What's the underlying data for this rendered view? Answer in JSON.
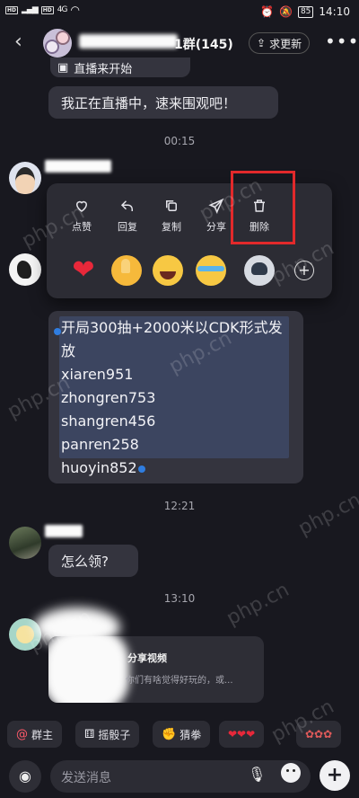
{
  "status_bar": {
    "time": "14:10",
    "battery": "85",
    "sim1": "HD",
    "sim2": "HD",
    "network": "4G"
  },
  "header": {
    "title": "1群(145)",
    "update_button": "求更新"
  },
  "messages": {
    "live_strip": "直播来开始",
    "live_msg": "我正在直播中，速来围观吧！",
    "time1": "00:15",
    "cdk_lines": [
      "开局300抽+2000米以CDK形式发",
      "放",
      "xiaren951",
      "zhongren753",
      "shangren456",
      "panren258",
      "huoyin852"
    ],
    "time2": "12:21",
    "howto": "怎么领?",
    "time3": "13:10",
    "share_title": "分享视频",
    "share_desc": "你们有啥觉得好玩的，或..."
  },
  "context_menu": {
    "items": [
      {
        "label": "点赞",
        "icon": "heart-outline-icon"
      },
      {
        "label": "回复",
        "icon": "reply-icon"
      },
      {
        "label": "复制",
        "icon": "copy-icon"
      },
      {
        "label": "分享",
        "icon": "share-icon"
      },
      {
        "label": "删除",
        "icon": "trash-icon"
      }
    ],
    "reactions": [
      "heart-emoji",
      "thumbs-up-emoji",
      "laughing-emoji",
      "crying-laugh-emoji",
      "dog-emoji"
    ],
    "highlight_color": "#e2292b"
  },
  "quick_chips": [
    "群主",
    "摇骰子",
    "猜拳"
  ],
  "input": {
    "placeholder": "发送消息"
  },
  "watermark": "php.cn"
}
